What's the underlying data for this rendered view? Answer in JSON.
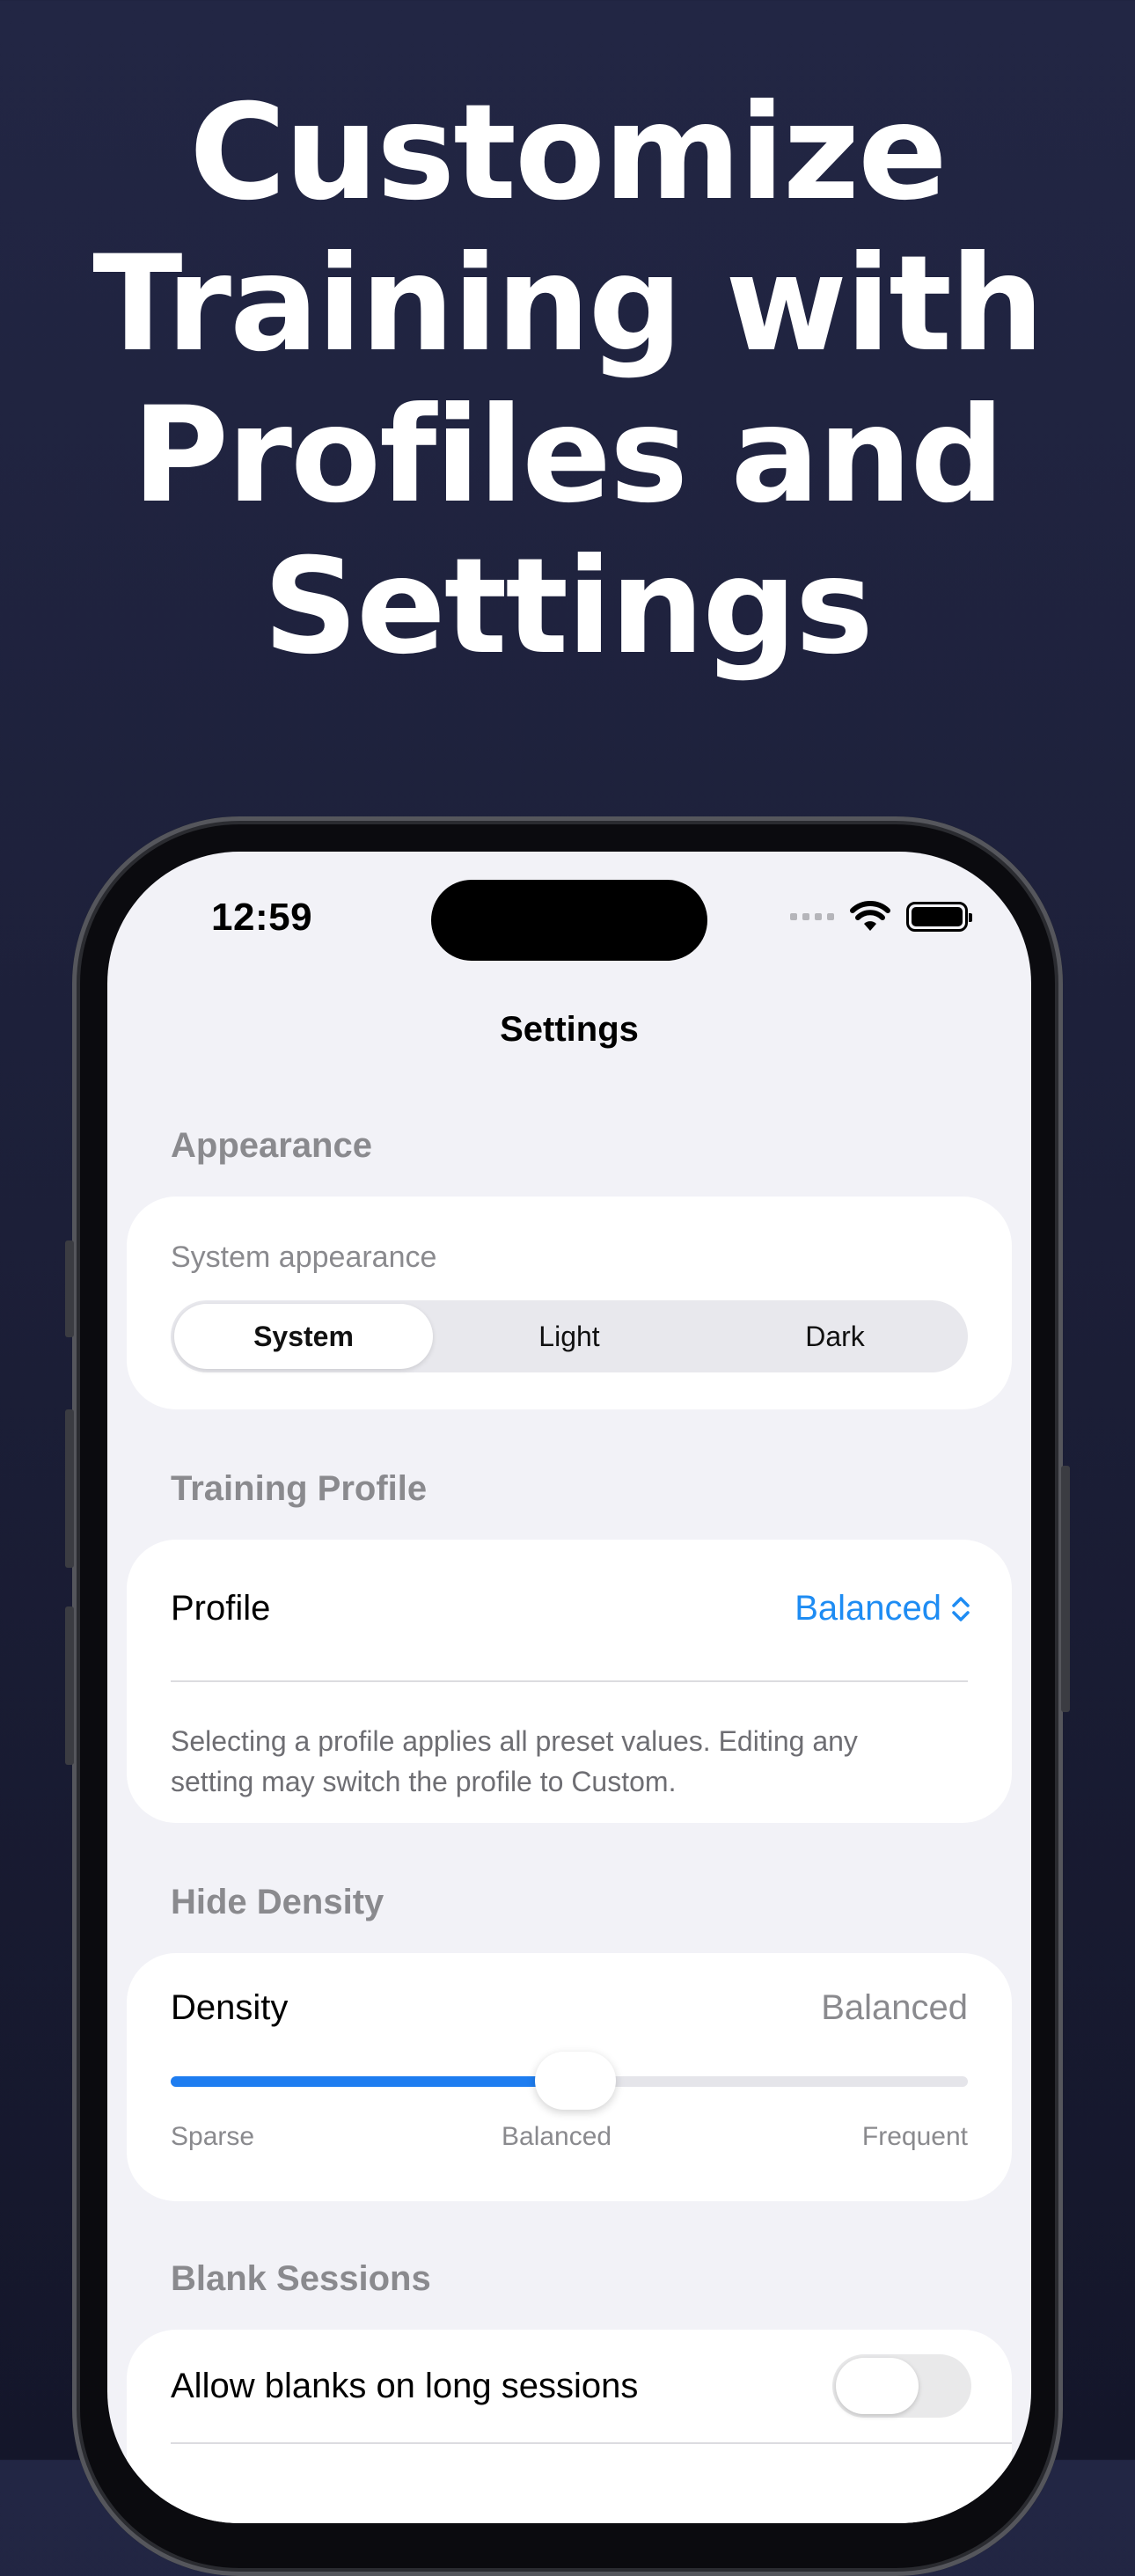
{
  "headline": {
    "lines": [
      "Customize",
      "Training with",
      "Profiles and",
      "Settings"
    ]
  },
  "status_bar": {
    "time": "12:59",
    "icons": [
      "cellular-signal-icon",
      "wifi-icon",
      "battery-icon"
    ]
  },
  "nav": {
    "title": "Settings"
  },
  "appearance": {
    "header": "Appearance",
    "label": "System appearance",
    "options": [
      "System",
      "Light",
      "Dark"
    ],
    "selected": "System"
  },
  "training_profile": {
    "header": "Training Profile",
    "row_label": "Profile",
    "value": "Balanced",
    "footnote_line1": "Selecting a profile applies all preset values. Editing any",
    "footnote_line2": "setting may switch the profile to Custom."
  },
  "hide_density": {
    "header": "Hide Density",
    "row_label": "Density",
    "value": "Balanced",
    "slider_fraction": 0.5,
    "ticks": [
      "Sparse",
      "Balanced",
      "Frequent"
    ]
  },
  "blank_sessions": {
    "header": "Blank Sessions",
    "row_label": "Allow blanks on long sessions",
    "toggle_on": false
  },
  "colors": {
    "background": "#222644",
    "accent": "#1e8cf3",
    "slider_fill": "#1e7df0"
  }
}
